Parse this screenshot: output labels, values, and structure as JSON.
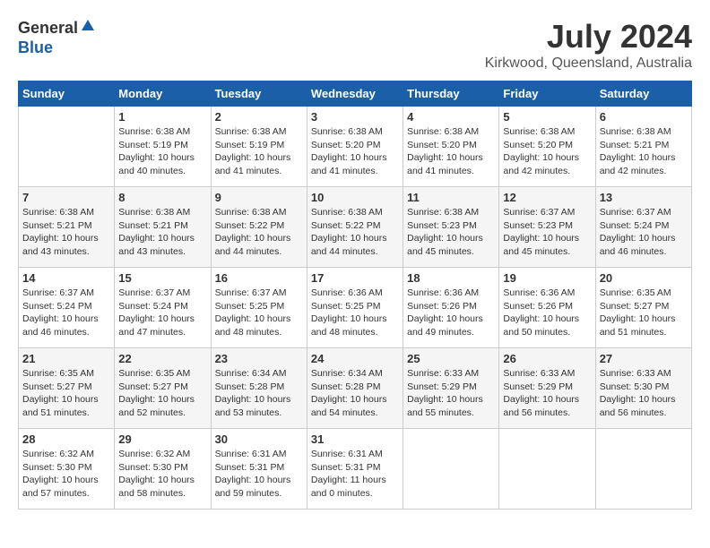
{
  "header": {
    "logo_general": "General",
    "logo_blue": "Blue",
    "month_year": "July 2024",
    "location": "Kirkwood, Queensland, Australia"
  },
  "calendar": {
    "days_of_week": [
      "Sunday",
      "Monday",
      "Tuesday",
      "Wednesday",
      "Thursday",
      "Friday",
      "Saturday"
    ],
    "weeks": [
      [
        {
          "day": "",
          "info": ""
        },
        {
          "day": "1",
          "info": "Sunrise: 6:38 AM\nSunset: 5:19 PM\nDaylight: 10 hours\nand 40 minutes."
        },
        {
          "day": "2",
          "info": "Sunrise: 6:38 AM\nSunset: 5:19 PM\nDaylight: 10 hours\nand 41 minutes."
        },
        {
          "day": "3",
          "info": "Sunrise: 6:38 AM\nSunset: 5:20 PM\nDaylight: 10 hours\nand 41 minutes."
        },
        {
          "day": "4",
          "info": "Sunrise: 6:38 AM\nSunset: 5:20 PM\nDaylight: 10 hours\nand 41 minutes."
        },
        {
          "day": "5",
          "info": "Sunrise: 6:38 AM\nSunset: 5:20 PM\nDaylight: 10 hours\nand 42 minutes."
        },
        {
          "day": "6",
          "info": "Sunrise: 6:38 AM\nSunset: 5:21 PM\nDaylight: 10 hours\nand 42 minutes."
        }
      ],
      [
        {
          "day": "7",
          "info": "Sunrise: 6:38 AM\nSunset: 5:21 PM\nDaylight: 10 hours\nand 43 minutes."
        },
        {
          "day": "8",
          "info": "Sunrise: 6:38 AM\nSunset: 5:21 PM\nDaylight: 10 hours\nand 43 minutes."
        },
        {
          "day": "9",
          "info": "Sunrise: 6:38 AM\nSunset: 5:22 PM\nDaylight: 10 hours\nand 44 minutes."
        },
        {
          "day": "10",
          "info": "Sunrise: 6:38 AM\nSunset: 5:22 PM\nDaylight: 10 hours\nand 44 minutes."
        },
        {
          "day": "11",
          "info": "Sunrise: 6:38 AM\nSunset: 5:23 PM\nDaylight: 10 hours\nand 45 minutes."
        },
        {
          "day": "12",
          "info": "Sunrise: 6:37 AM\nSunset: 5:23 PM\nDaylight: 10 hours\nand 45 minutes."
        },
        {
          "day": "13",
          "info": "Sunrise: 6:37 AM\nSunset: 5:24 PM\nDaylight: 10 hours\nand 46 minutes."
        }
      ],
      [
        {
          "day": "14",
          "info": "Sunrise: 6:37 AM\nSunset: 5:24 PM\nDaylight: 10 hours\nand 46 minutes."
        },
        {
          "day": "15",
          "info": "Sunrise: 6:37 AM\nSunset: 5:24 PM\nDaylight: 10 hours\nand 47 minutes."
        },
        {
          "day": "16",
          "info": "Sunrise: 6:37 AM\nSunset: 5:25 PM\nDaylight: 10 hours\nand 48 minutes."
        },
        {
          "day": "17",
          "info": "Sunrise: 6:36 AM\nSunset: 5:25 PM\nDaylight: 10 hours\nand 48 minutes."
        },
        {
          "day": "18",
          "info": "Sunrise: 6:36 AM\nSunset: 5:26 PM\nDaylight: 10 hours\nand 49 minutes."
        },
        {
          "day": "19",
          "info": "Sunrise: 6:36 AM\nSunset: 5:26 PM\nDaylight: 10 hours\nand 50 minutes."
        },
        {
          "day": "20",
          "info": "Sunrise: 6:35 AM\nSunset: 5:27 PM\nDaylight: 10 hours\nand 51 minutes."
        }
      ],
      [
        {
          "day": "21",
          "info": "Sunrise: 6:35 AM\nSunset: 5:27 PM\nDaylight: 10 hours\nand 51 minutes."
        },
        {
          "day": "22",
          "info": "Sunrise: 6:35 AM\nSunset: 5:27 PM\nDaylight: 10 hours\nand 52 minutes."
        },
        {
          "day": "23",
          "info": "Sunrise: 6:34 AM\nSunset: 5:28 PM\nDaylight: 10 hours\nand 53 minutes."
        },
        {
          "day": "24",
          "info": "Sunrise: 6:34 AM\nSunset: 5:28 PM\nDaylight: 10 hours\nand 54 minutes."
        },
        {
          "day": "25",
          "info": "Sunrise: 6:33 AM\nSunset: 5:29 PM\nDaylight: 10 hours\nand 55 minutes."
        },
        {
          "day": "26",
          "info": "Sunrise: 6:33 AM\nSunset: 5:29 PM\nDaylight: 10 hours\nand 56 minutes."
        },
        {
          "day": "27",
          "info": "Sunrise: 6:33 AM\nSunset: 5:30 PM\nDaylight: 10 hours\nand 56 minutes."
        }
      ],
      [
        {
          "day": "28",
          "info": "Sunrise: 6:32 AM\nSunset: 5:30 PM\nDaylight: 10 hours\nand 57 minutes."
        },
        {
          "day": "29",
          "info": "Sunrise: 6:32 AM\nSunset: 5:30 PM\nDaylight: 10 hours\nand 58 minutes."
        },
        {
          "day": "30",
          "info": "Sunrise: 6:31 AM\nSunset: 5:31 PM\nDaylight: 10 hours\nand 59 minutes."
        },
        {
          "day": "31",
          "info": "Sunrise: 6:31 AM\nSunset: 5:31 PM\nDaylight: 11 hours\nand 0 minutes."
        },
        {
          "day": "",
          "info": ""
        },
        {
          "day": "",
          "info": ""
        },
        {
          "day": "",
          "info": ""
        }
      ]
    ]
  }
}
